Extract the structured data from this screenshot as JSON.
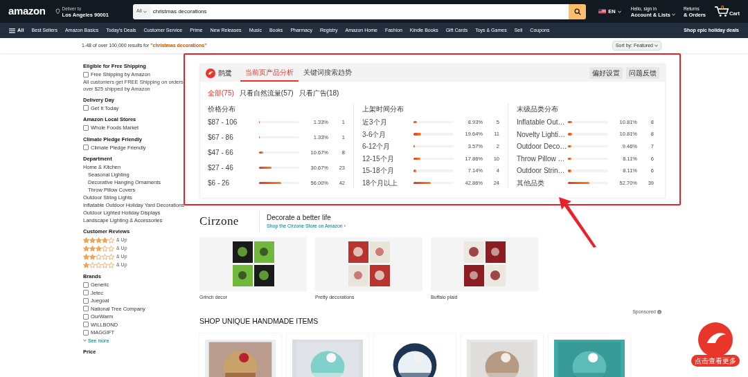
{
  "header": {
    "logo": "amazon",
    "deliver_label": "Deliver to",
    "location": "Los Angeles 90001",
    "search_category": "All",
    "search_value": "christmas decorations",
    "language": "EN",
    "account_greeting": "Hello, sign in",
    "account_label": "Account & Lists",
    "returns_label": "Returns",
    "orders_label": "& Orders",
    "cart_count": "0",
    "cart_label": "Cart"
  },
  "nav": {
    "menu_label": "All",
    "items": [
      "Best Sellers",
      "Amazon Basics",
      "Today's Deals",
      "Customer Service",
      "Prime",
      "New Releases",
      "Music",
      "Books",
      "Pharmacy",
      "Registry",
      "Amazon Home",
      "Fashion",
      "Kindle Books",
      "Gift Cards",
      "Toys & Games",
      "Sell",
      "Coupons"
    ],
    "promo": "Shop epic holiday deals"
  },
  "results": {
    "count_text": "1-48 of over 100,000 results for",
    "query": "\"christmas decorations\"",
    "sort_label": "Sort by:",
    "sort_value": "Featured"
  },
  "sidebar": {
    "sections": [
      {
        "title": "Eligible for Free Shipping",
        "items": [
          {
            "kind": "checkbox",
            "label": "Free Shipping by Amazon",
            "checked": false
          },
          {
            "kind": "note",
            "label": "All customers get FREE Shipping on orders over $25 shipped by Amazon"
          }
        ]
      },
      {
        "title": "Delivery Day",
        "items": [
          {
            "kind": "checkbox",
            "label": "Get It Today",
            "checked": false
          }
        ]
      },
      {
        "title": "Amazon Local Stores",
        "items": [
          {
            "kind": "checkbox",
            "label": "Whole Foods Market",
            "checked": false
          }
        ]
      },
      {
        "title": "Climate Pledge Friendly",
        "items": [
          {
            "kind": "checkbox",
            "label": "Climate Pledge Friendly",
            "checked": false
          }
        ]
      },
      {
        "title": "Department",
        "items": [
          {
            "kind": "link",
            "label": "Home & Kitchen",
            "children": [
              {
                "kind": "link",
                "label": "Seasonal Lighting"
              },
              {
                "kind": "link",
                "label": "Decorative Hanging Ornaments"
              },
              {
                "kind": "link",
                "label": "Throw Pillow Covers"
              }
            ]
          },
          {
            "kind": "link",
            "label": "Outdoor String Lights"
          },
          {
            "kind": "link",
            "label": "Inflatable Outdoor Holiday Yard Decorations"
          },
          {
            "kind": "link",
            "label": "Outdoor Lighted Holiday Displays"
          },
          {
            "kind": "link",
            "label": "Landscape Lighting & Accessories"
          }
        ]
      },
      {
        "title": "Customer Reviews",
        "items": [
          {
            "kind": "rating",
            "stars": 4,
            "label": "& Up"
          },
          {
            "kind": "rating",
            "stars": 3,
            "label": "& Up"
          },
          {
            "kind": "rating",
            "stars": 2,
            "label": "& Up"
          },
          {
            "kind": "rating",
            "stars": 1,
            "label": "& Up"
          }
        ]
      },
      {
        "title": "Brands",
        "items": [
          {
            "kind": "checkbox",
            "label": "Generic",
            "checked": false
          },
          {
            "kind": "checkbox",
            "label": "Jetec",
            "checked": false
          },
          {
            "kind": "checkbox",
            "label": "Juegoal",
            "checked": false
          },
          {
            "kind": "checkbox",
            "label": "National Tree Company",
            "checked": false
          },
          {
            "kind": "checkbox",
            "label": "OurWarm",
            "checked": false
          },
          {
            "kind": "checkbox",
            "label": "WILLBOND",
            "checked": false
          },
          {
            "kind": "checkbox",
            "label": "MAGGIFT",
            "checked": false
          },
          {
            "kind": "more",
            "label": "See more"
          }
        ]
      },
      {
        "title": "Price"
      }
    ]
  },
  "plugin": {
    "brand": "鹊鹭",
    "tabs": [
      {
        "label": "当前页产品分析",
        "selected": true
      },
      {
        "label": "关键词搜索趋势",
        "selected": false
      }
    ],
    "buttons": [
      "偏好设置",
      "问题反馈"
    ],
    "filters": [
      {
        "label": "全部(75)",
        "selected": true
      },
      {
        "label": "只看自然流量(57)",
        "selected": false
      },
      {
        "label": "只看广告(18)",
        "selected": false
      }
    ],
    "groups": [
      {
        "title": "价格分布",
        "rows": [
          {
            "label": "$87 - 106",
            "level": 0.0133,
            "percent": "1.33%",
            "count": "1"
          },
          {
            "label": "$67 - 86",
            "level": 0.0133,
            "percent": "1.33%",
            "count": "1"
          },
          {
            "label": "$47 - 66",
            "level": 0.1067,
            "percent": "10.67%",
            "count": "8"
          },
          {
            "label": "$27 - 46",
            "level": 0.3067,
            "percent": "30.67%",
            "count": "23"
          },
          {
            "label": "$6 - 26",
            "level": 0.56,
            "percent": "56.00%",
            "count": "42"
          }
        ]
      },
      {
        "title": "上架时间分布",
        "rows": [
          {
            "label": "近3个月",
            "level": 0.0893,
            "percent": "8.93%",
            "count": "5"
          },
          {
            "label": "3-6个月",
            "level": 0.1964,
            "percent": "19.64%",
            "count": "11"
          },
          {
            "label": "6-12个月",
            "level": 0.0357,
            "percent": "3.57%",
            "count": "2"
          },
          {
            "label": "12-15个月",
            "level": 0.1786,
            "percent": "17.86%",
            "count": "10"
          },
          {
            "label": "15-18个月",
            "level": 0.0714,
            "percent": "7.14%",
            "count": "4"
          },
          {
            "label": "18个月以上",
            "level": 0.4286,
            "percent": "42.86%",
            "count": "24"
          }
        ]
      },
      {
        "title": "末级品类分布",
        "rows": [
          {
            "label": "Inflatable Out…",
            "level": 0.1081,
            "percent": "10.81%",
            "count": "8"
          },
          {
            "label": "Novelty Lighti…",
            "level": 0.1081,
            "percent": "10.81%",
            "count": "8"
          },
          {
            "label": "Outdoor Deco…",
            "level": 0.0946,
            "percent": "9.46%",
            "count": "7"
          },
          {
            "label": "Throw Pillow …",
            "level": 0.0811,
            "percent": "8.11%",
            "count": "6"
          },
          {
            "label": "Outdoor Strin…",
            "level": 0.0811,
            "percent": "8.11%",
            "count": "6"
          },
          {
            "label": "其他品类",
            "level": 0.527,
            "percent": "52.70%",
            "count": "39"
          }
        ]
      }
    ]
  },
  "brand_banner": {
    "logo": "Cirzone",
    "tagline": "Decorate a better life",
    "link": "Shop the Cirzone Store on Amazon ›",
    "cards": [
      {
        "caption": "Grinch decor"
      },
      {
        "caption": "Pretty decorations"
      },
      {
        "caption": "Buffalo plaid"
      }
    ]
  },
  "sponsored": "Sponsored",
  "handmade": {
    "title": "SHOP UNIQUE HANDMADE ITEMS"
  },
  "floating_button": {
    "label": "点击查看更多"
  }
}
